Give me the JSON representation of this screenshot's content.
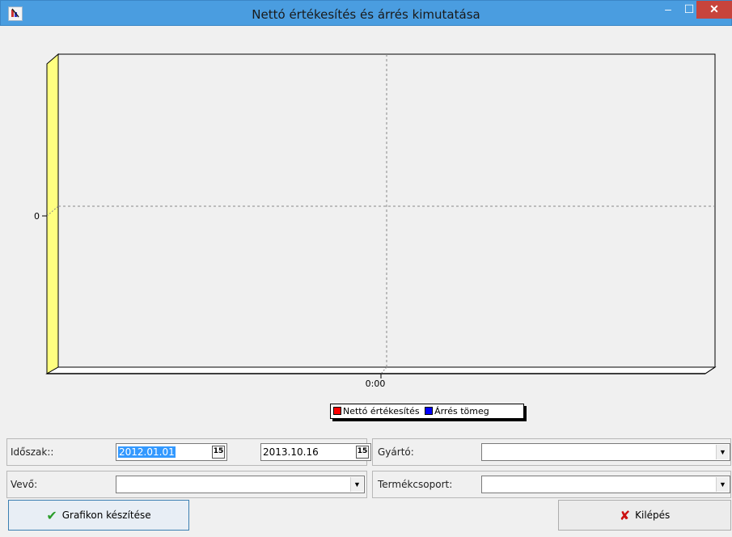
{
  "window": {
    "title": "Nettó értékesítés és árrés kimutatása",
    "minimize": "–",
    "maximize": "☐",
    "close": "✕"
  },
  "chart_data": {
    "type": "bar",
    "categories": [
      "0:00"
    ],
    "series": [
      {
        "name": "Nettó értékesítés",
        "values": [
          0
        ],
        "color": "#ff0000"
      },
      {
        "name": "Árrés tömeg",
        "values": [
          0
        ],
        "color": "#0000ff"
      }
    ],
    "ytick_labels": [
      "0"
    ],
    "xtick_labels": [
      "0:00"
    ],
    "grid": true,
    "legend_position": "bottom-center",
    "wall_color": "#ffff80"
  },
  "filters": {
    "period_label": "Időszak::",
    "date_from": "2012.01.01",
    "date_to": "2013.10.16",
    "calendar_glyph": "15",
    "manufacturer_label": "Gyártó:",
    "manufacturer_value": "",
    "customer_label": "Vevő:",
    "customer_value": "",
    "product_group_label": "Termékcsoport:",
    "product_group_value": "",
    "dropdown_arrow": "▼"
  },
  "actions": {
    "make_chart_label": "Grafikon készítése",
    "make_chart_icon": "✔",
    "exit_label": "Kilépés",
    "exit_icon": "✘",
    "check_color": "#2a9d2a",
    "cross_color": "#cc1111"
  }
}
